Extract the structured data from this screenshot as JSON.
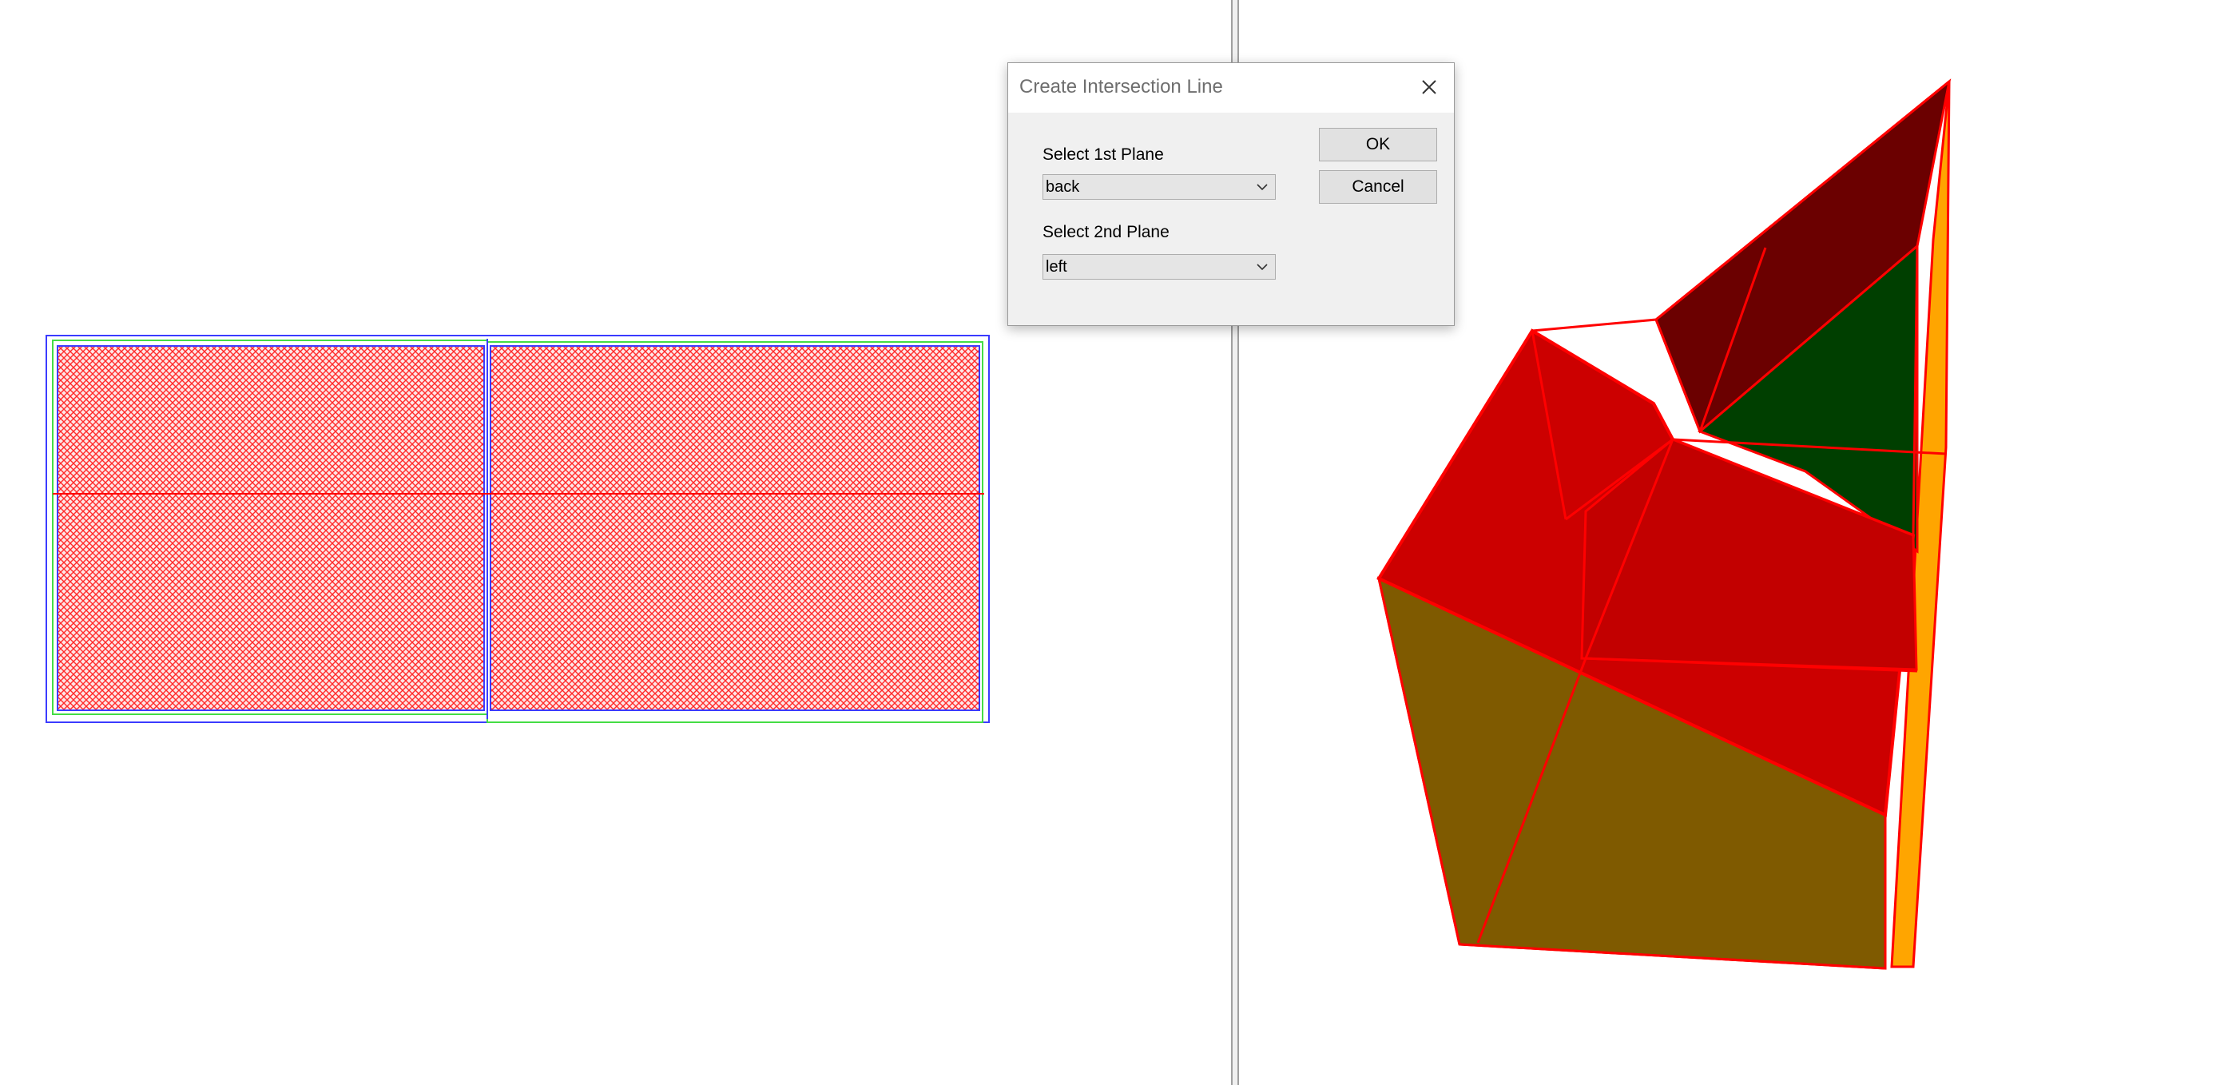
{
  "dialog": {
    "title": "Create Intersection Line",
    "close_icon": "close-icon",
    "first_plane_label": "Select 1st Plane",
    "first_plane_value": "back",
    "second_plane_label": "Select 2nd Plane",
    "second_plane_value": "left",
    "ok_label": "OK",
    "cancel_label": "Cancel",
    "dropdown_icon": "chevron-down-icon"
  },
  "viewport_2d": {
    "panel_fill": "#ff3b3b",
    "panel_hatch": "cross-hatch",
    "outline_blue": "#3b3bff",
    "outline_green": "#44dd44",
    "midline": "#ff0000"
  },
  "viewport_3d": {
    "edge_color": "#ff0000",
    "face_colors": {
      "red": "#cc0000",
      "dark_red": "#6b0000",
      "green": "#003f00",
      "olive": "#7f5a00",
      "orange": "#ffa500"
    }
  }
}
